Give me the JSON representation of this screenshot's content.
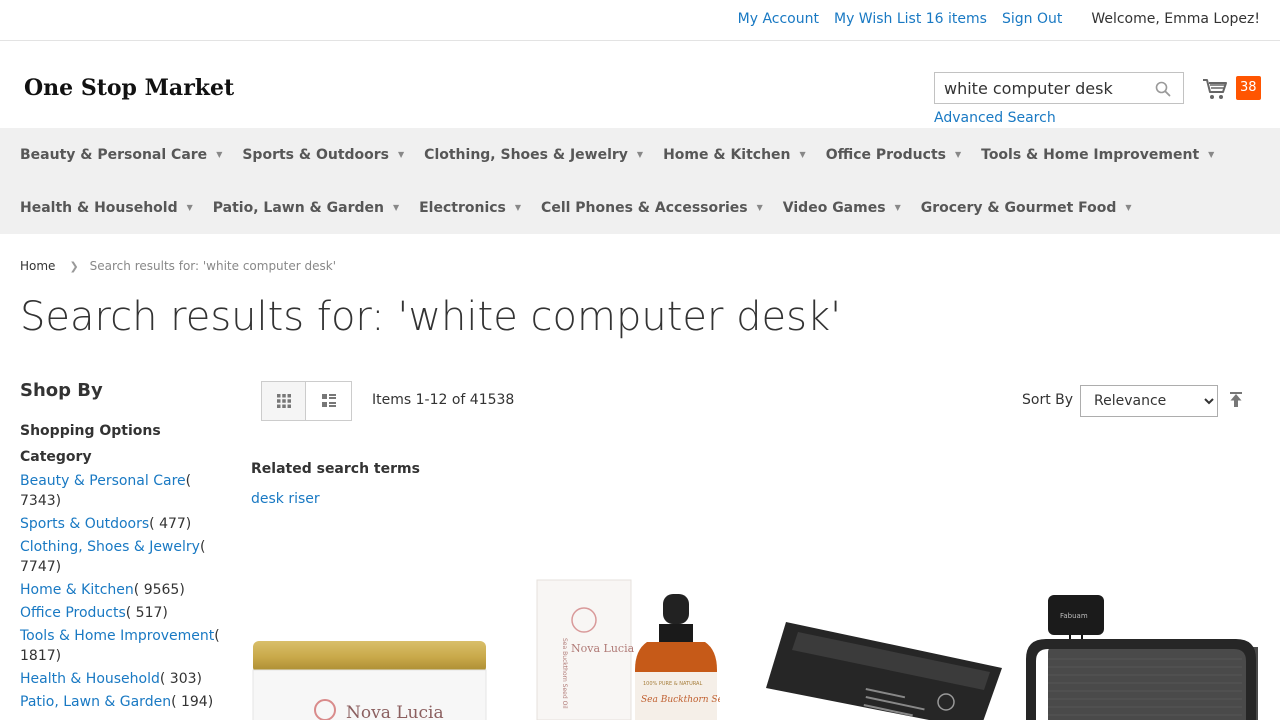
{
  "top_links": {
    "my_account": "My Account",
    "wish_list": "My Wish List 16 items",
    "sign_out": "Sign Out",
    "welcome": "Welcome, Emma Lopez!"
  },
  "logo": "One Stop Market",
  "search": {
    "value": "white computer desk",
    "icon": "search-icon"
  },
  "advanced_search": "Advanced Search",
  "cart": {
    "icon": "cart-icon",
    "count": "38",
    "badge_color": "#ff5501"
  },
  "nav": {
    "row1": [
      "Beauty & Personal Care",
      "Sports & Outdoors",
      "Clothing, Shoes & Jewelry",
      "Home & Kitchen",
      "Office Products",
      "Tools & Home Improvement"
    ],
    "row2": [
      "Health & Household",
      "Patio, Lawn & Garden",
      "Electronics",
      "Cell Phones & Accessories",
      "Video Games",
      "Grocery & Gourmet Food"
    ]
  },
  "breadcrumb": {
    "home": "Home",
    "current": "Search results for: 'white computer desk'"
  },
  "page_title": "Search results for: 'white computer desk'",
  "sidebar": {
    "shop_by": "Shop By",
    "shopping_options": "Shopping Options",
    "category_title": "Category",
    "categories": [
      {
        "label": "Beauty & Personal Care",
        "count": "( 7343)"
      },
      {
        "label": "Sports & Outdoors",
        "count": "( 477)"
      },
      {
        "label": "Clothing, Shoes & Jewelry",
        "count": "( 7747)"
      },
      {
        "label": "Home & Kitchen",
        "count": "( 9565)"
      },
      {
        "label": "Office Products",
        "count": "( 517)"
      },
      {
        "label": "Tools & Home Improvement",
        "count": "( 1817)"
      },
      {
        "label": "Health & Household",
        "count": "( 303)"
      },
      {
        "label": "Patio, Lawn & Garden",
        "count": "( 194)"
      }
    ]
  },
  "toolbar": {
    "items_count": "Items 1-12 of 41538",
    "sort_by_label": "Sort By",
    "sort_selected": "Relevance",
    "sort_options": [
      "Relevance"
    ]
  },
  "related": {
    "title": "Related search terms",
    "term": "desk riser"
  },
  "products": {
    "jar_label": "Nova Lucia",
    "bottle_brand": "Nova Lucia",
    "bottle_tagline": "100% PURE & NATURAL",
    "bottle_product": "Sea Buckthorn Seed Oil",
    "box_product": "Sea Buckthorn Seed Oil",
    "speaker_brand": "Fabuam"
  }
}
